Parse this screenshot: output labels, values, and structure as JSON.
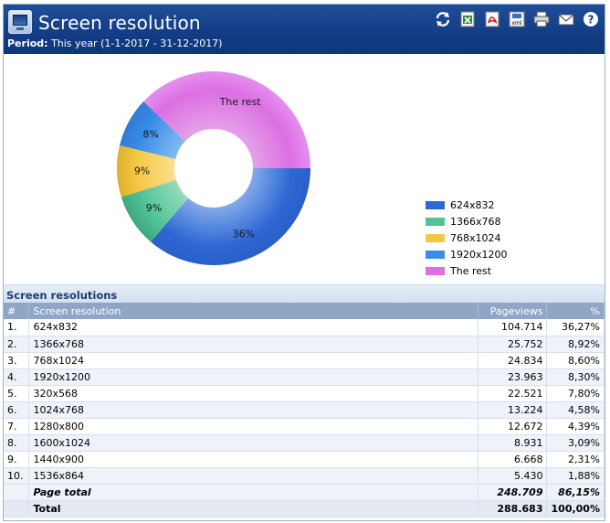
{
  "header": {
    "title": "Screen resolution",
    "period_label": "Period:",
    "period_value": "This year (1-1-2017 - 31-12-2017)"
  },
  "toolbar": {
    "icons": [
      "refresh-icon",
      "excel-icon",
      "pdf-icon",
      "xml-icon",
      "print-icon",
      "email-icon",
      "help-icon"
    ]
  },
  "chart_data": {
    "type": "pie",
    "title": "",
    "donut": true,
    "categories": [
      "624x832",
      "1366x768",
      "768x1024",
      "1920x1200",
      "The rest"
    ],
    "values": [
      36.27,
      8.92,
      8.6,
      8.3,
      37.91
    ],
    "labels": [
      "36%",
      "9%",
      "9%",
      "8%",
      "The rest"
    ],
    "colors": [
      "#2e68d4",
      "#52c396",
      "#f5c842",
      "#3a8ce8",
      "#dc6fe3"
    ],
    "legend": [
      "624x832",
      "1366x768",
      "768x1024",
      "1920x1200",
      "The rest"
    ],
    "legend_position": "right"
  },
  "section": {
    "title": "Screen resolutions"
  },
  "table": {
    "headers": {
      "idx": "#",
      "name": "Screen resolution",
      "pageviews": "Pageviews",
      "pct": "%"
    },
    "rows": [
      {
        "idx": "1.",
        "name": "624x832",
        "pageviews": "104.714",
        "pct": "36,27%"
      },
      {
        "idx": "2.",
        "name": "1366x768",
        "pageviews": "25.752",
        "pct": "8,92%"
      },
      {
        "idx": "3.",
        "name": "768x1024",
        "pageviews": "24.834",
        "pct": "8,60%"
      },
      {
        "idx": "4.",
        "name": "1920x1200",
        "pageviews": "23.963",
        "pct": "8,30%"
      },
      {
        "idx": "5.",
        "name": "320x568",
        "pageviews": "22.521",
        "pct": "7,80%"
      },
      {
        "idx": "6.",
        "name": "1024x768",
        "pageviews": "13.224",
        "pct": "4,58%"
      },
      {
        "idx": "7.",
        "name": "1280x800",
        "pageviews": "12.672",
        "pct": "4,39%"
      },
      {
        "idx": "8.",
        "name": "1600x1024",
        "pageviews": "8.931",
        "pct": "3,09%"
      },
      {
        "idx": "9.",
        "name": "1440x900",
        "pageviews": "6.668",
        "pct": "2,31%"
      },
      {
        "idx": "10.",
        "name": "1536x864",
        "pageviews": "5.430",
        "pct": "1,88%"
      }
    ],
    "page_total": {
      "label": "Page total",
      "pageviews": "248.709",
      "pct": "86,15%"
    },
    "total": {
      "label": "Total",
      "pageviews": "288.683",
      "pct": "100,00%"
    }
  }
}
